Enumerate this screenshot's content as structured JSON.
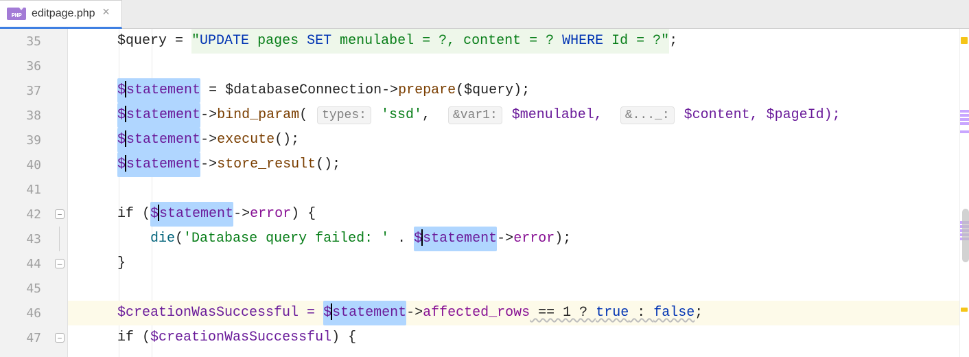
{
  "tab": {
    "filename": "editpage.php"
  },
  "lines": {
    "start": 35,
    "end": 47
  },
  "code": {
    "l35": {
      "prefix": "    $query = ",
      "q1": "\"",
      "kw_update": "UPDATE",
      "sql1": " pages ",
      "kw_set": "SET",
      "sql2": " menulabel = ?, content = ? ",
      "kw_where": "WHERE",
      "sql3": " Id = ?\"",
      "suffix": ";"
    },
    "l37": {
      "indent": "    ",
      "var_d": "$",
      "sel": "statement",
      "rest1": " = $databaseConnection->",
      "method": "prepare",
      "rest2": "($query);"
    },
    "l38": {
      "indent": "    ",
      "var_d": "$",
      "sel": "statement",
      "rest1": "->",
      "method": "bind_param",
      "open": "( ",
      "hint1": "types:",
      "str": " 'ssd'",
      "comma1": ",  ",
      "hint2": "&var1:",
      "arg1": " $menulabel,  ",
      "hint3": "&..._:",
      "arg2": " $content, $pageId);"
    },
    "l39": {
      "indent": "    ",
      "var_d": "$",
      "sel": "statement",
      "rest1": "->",
      "method": "execute",
      "rest2": "();"
    },
    "l40": {
      "indent": "    ",
      "var_d": "$",
      "sel": "statement",
      "rest1": "->",
      "method": "store_result",
      "rest2": "();"
    },
    "l42": {
      "indent": "    ",
      "kw": "if (",
      "var_d": "$",
      "sel": "statement",
      "rest1": "->",
      "field": "error",
      "rest2": ") {"
    },
    "l43": {
      "indent": "        ",
      "func": "die",
      "open": "(",
      "str": "'Database query failed: '",
      "concat": " . ",
      "var_d": "$",
      "sel": "statement",
      "rest1": "->",
      "field": "error",
      "rest2": ");"
    },
    "l44": {
      "text": "    }"
    },
    "l46": {
      "indent": "    ",
      "lhs": "$creationWasSuccessful = ",
      "var_d": "$",
      "sel": "statement",
      "rest1": "->",
      "field": "affected_rows",
      "wavy": " == 1 ? ",
      "true": "true",
      "mid": " : ",
      "false": "false",
      "end": ";"
    },
    "l47": {
      "indent": "    ",
      "kw": "if (",
      "var": "$creationWasSuccessful",
      "rest": ") {"
    }
  },
  "colors": {
    "selection": "#b0d6ff",
    "current_line": "#fdfae9"
  }
}
